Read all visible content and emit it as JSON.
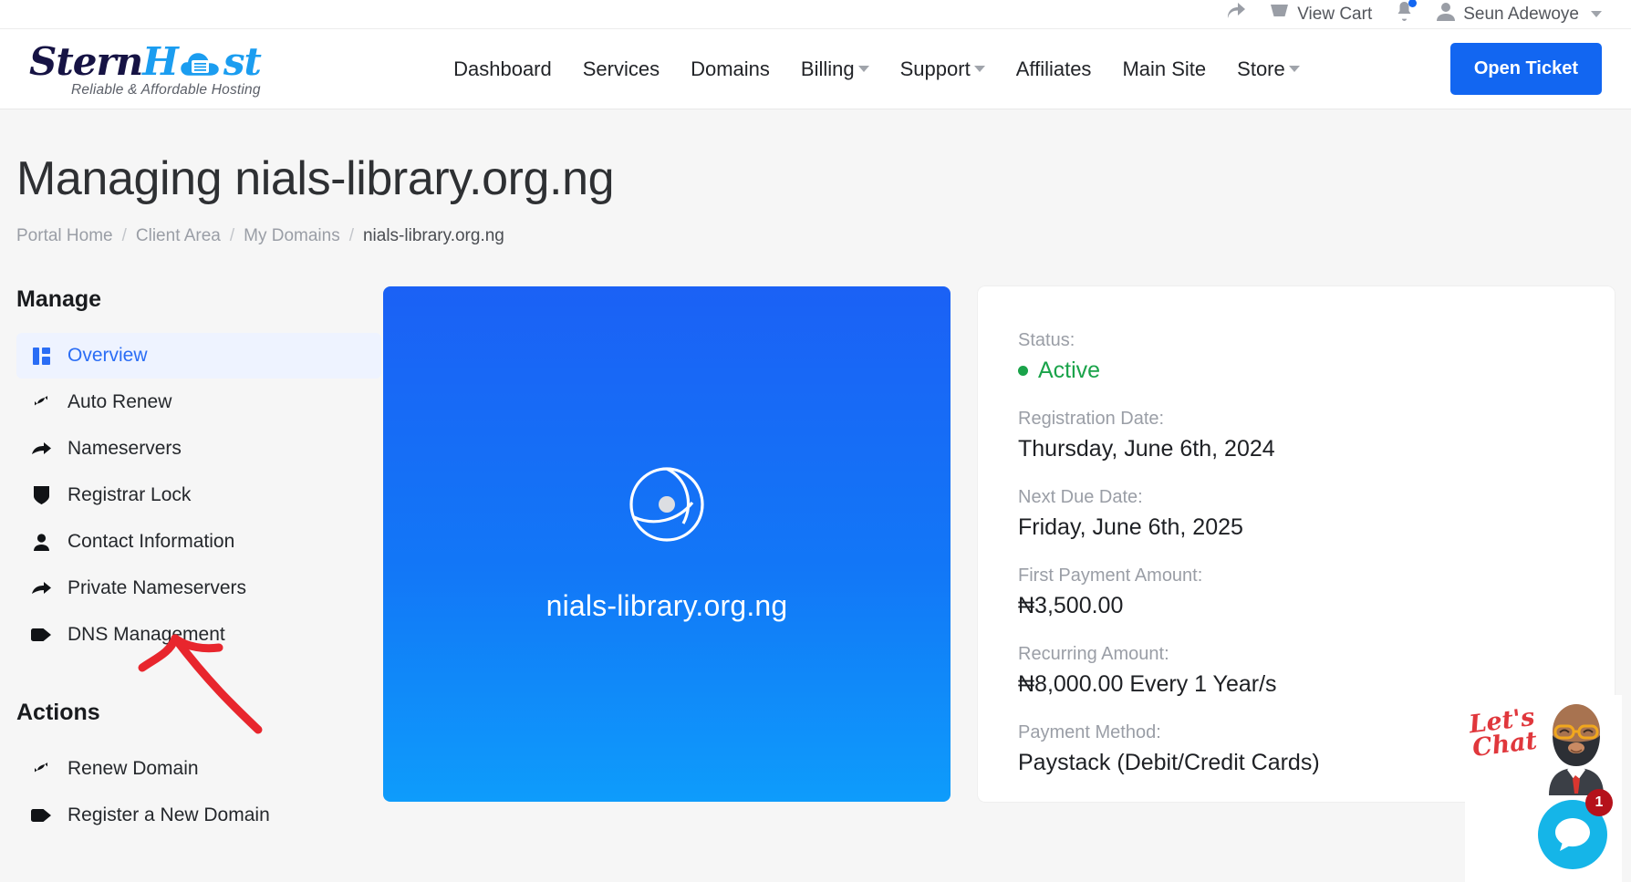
{
  "topbar": {
    "share_icon": "share-icon",
    "cart_icon": "cart-icon",
    "cart_label": "View Cart",
    "bell_icon": "bell-icon",
    "user_icon": "user-icon",
    "user_name": "Seun Adewoye"
  },
  "brand": {
    "name_part1": "Stern",
    "name_part2": "H",
    "name_part3": "st",
    "tagline": "Reliable & Affordable Hosting"
  },
  "nav": {
    "items": [
      {
        "label": "Dashboard",
        "caret": false
      },
      {
        "label": "Services",
        "caret": false
      },
      {
        "label": "Domains",
        "caret": false
      },
      {
        "label": "Billing",
        "caret": true
      },
      {
        "label": "Support",
        "caret": true
      },
      {
        "label": "Affiliates",
        "caret": false
      },
      {
        "label": "Main Site",
        "caret": false
      },
      {
        "label": "Store",
        "caret": true
      }
    ],
    "open_ticket": "Open Ticket"
  },
  "page": {
    "title": "Managing nials-library.org.ng",
    "breadcrumb": [
      {
        "label": "Portal Home",
        "active": false
      },
      {
        "label": "Client Area",
        "active": false
      },
      {
        "label": "My Domains",
        "active": false
      },
      {
        "label": "nials-library.org.ng",
        "active": true
      }
    ],
    "breadcrumb_separator": "/"
  },
  "sidebar": {
    "manage_heading": "Manage",
    "manage_items": [
      {
        "label": "Overview",
        "icon": "dashboard-icon",
        "active": true
      },
      {
        "label": "Auto Renew",
        "icon": "refresh-icon",
        "active": false
      },
      {
        "label": "Nameservers",
        "icon": "arrow-right-icon",
        "active": false
      },
      {
        "label": "Registrar Lock",
        "icon": "shield-icon",
        "active": false
      },
      {
        "label": "Contact Information",
        "icon": "person-icon",
        "active": false
      },
      {
        "label": "Private Nameservers",
        "icon": "arrow-right-icon",
        "active": false
      },
      {
        "label": "DNS Management",
        "icon": "tag-icon",
        "active": false
      }
    ],
    "actions_heading": "Actions",
    "action_items": [
      {
        "label": "Renew Domain",
        "icon": "refresh-icon"
      },
      {
        "label": "Register a New Domain",
        "icon": "tag-icon"
      }
    ]
  },
  "domain_card": {
    "icon": "globe-icon",
    "domain": "nials-library.org.ng",
    "gradient_top": "#1b61f5",
    "gradient_bottom": "#0e9cfb"
  },
  "details": {
    "status_label": "Status:",
    "status_value": "Active",
    "status_color": "#1aa34a",
    "registration_label": "Registration Date:",
    "registration_value": "Thursday, June 6th, 2024",
    "next_due_label": "Next Due Date:",
    "next_due_value": "Friday, June 6th, 2025",
    "first_payment_label": "First Payment Amount:",
    "first_payment_value": "₦3,500.00",
    "recurring_label": "Recurring Amount:",
    "recurring_value": "₦8,000.00 Every 1 Year/s",
    "payment_method_label": "Payment Method:",
    "payment_method_value": "Paystack (Debit/Credit Cards)"
  },
  "chat": {
    "prompt_line1": "Let's",
    "prompt_line2": "Chat",
    "badge_count": "1",
    "bubble_icon": "chat-bubble-icon",
    "agent_icon": "agent-avatar"
  },
  "annotation": {
    "arrow": "red-arrow-annotation",
    "color": "#e8262d"
  }
}
